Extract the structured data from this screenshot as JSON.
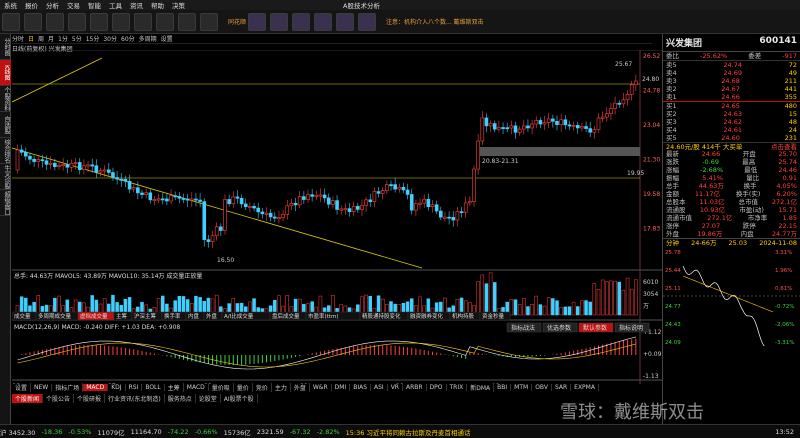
{
  "app": {
    "title": "A股技术分析",
    "logo": "同花顺",
    "notice": "注意：机构介入八个"
  },
  "menu": [
    "系统",
    "报价",
    "分析",
    "交易",
    "智能",
    "工具",
    "资讯",
    "帮助",
    "决策"
  ],
  "toolbar_ticker": "注意：机构介入八个数... 戴维斯双击",
  "leftnav": [
    "分时图",
    "K线图",
    "个股资料",
    "自选股",
    "综合排名",
    "牛叉诊股",
    "超级盘口"
  ],
  "leftnav_active": 1,
  "periods": [
    "分时",
    "日",
    "周",
    "月",
    "1分",
    "5分",
    "15分",
    "30分",
    "60分",
    "多周期",
    "设置"
  ],
  "period_selected": 1,
  "chart_header": "日线(前复权) 兴发集团",
  "price_labels": [
    "26.52",
    "24.78",
    "23.04",
    "21.30",
    "19.58",
    "17.83"
  ],
  "price_annotations": {
    "high": "25.67",
    "right": "24.80",
    "box": "20.83-21.31",
    "line": "19.95",
    "low": "16.50"
  },
  "vol_header": "总手: 44.63万  MAVOL5: 43.89万  MAVOL10: 35.14万  成交量正放量",
  "vol_labels": [
    "6010",
    "3054",
    "万"
  ],
  "indicator_tabs": [
    "成交量",
    "多周期成交量",
    "虚拟成交量",
    "主筹",
    "沪深主筹",
    "换手率",
    "内盘",
    "外盘",
    "A/I比成交量",
    "盘后成交量",
    "市盈率(ttm)",
    "精股通持股变化",
    "融资融券变化",
    "机构持股",
    "资金秒量"
  ],
  "macd_header": "MACD(12,26,9)  MACD: -0.240  DIFF: +1.03  DEA: +0.908",
  "macd_labels": [
    "+1.12",
    "+0.097",
    "-1.13"
  ],
  "chart_buttons": [
    "指标战法",
    "优选参数",
    "默认参数",
    "指标说明"
  ],
  "x_axis": [
    "06",
    "07",
    "08",
    "09",
    "10",
    "11"
  ],
  "bottom_tabs_row1": [
    "设置",
    "NEW",
    "指标广场",
    "MACD",
    "KDJ",
    "RSI",
    "BOLL",
    "主筹",
    "MACD",
    "量价吸",
    "量价",
    "竞价",
    "主力",
    "外盘",
    "W&R",
    "DMI",
    "BIAS",
    "ASI",
    "VR",
    "ARBR",
    "DPO",
    "TRIX",
    "新DMA",
    "BBI",
    "MTM",
    "OBV",
    "SAR",
    "EXPMA"
  ],
  "bottom_tabs_row2": [
    "个股新闻",
    "个股公告",
    "个股研报",
    "行业资讯(东北制造)",
    "服务热点",
    "论股堂",
    "AI股票个股"
  ],
  "quote": {
    "name": "兴发集团",
    "code": "600141",
    "weibi": "-25.62%",
    "weicha": "-917",
    "asks": [
      [
        "5",
        "24.74",
        "72"
      ],
      [
        "4",
        "24.69",
        "49"
      ],
      [
        "3",
        "24.68",
        "211"
      ],
      [
        "2",
        "24.67",
        "441"
      ],
      [
        "1",
        "24.66",
        "355"
      ]
    ],
    "bids": [
      [
        "1",
        "24.65",
        "480"
      ],
      [
        "2",
        "24.63",
        "15"
      ],
      [
        "3",
        "24.62",
        "48"
      ],
      [
        "4",
        "24.61",
        "24"
      ],
      [
        "5",
        "24.60",
        "231"
      ]
    ],
    "last_line": "24.60元/股  414千  大买单",
    "sub_title": "点击查看",
    "fields": [
      [
        "最新",
        "24.66",
        "开盘",
        "25.70"
      ],
      [
        "涨跌",
        "-0.69",
        "最高",
        "25.74"
      ],
      [
        "涨幅",
        "-2.68%",
        "最低",
        "24.46"
      ],
      [
        "振幅",
        "5.41%",
        "量比",
        "0.91"
      ],
      [
        "总手",
        "44.63万",
        "换手",
        "4.05%"
      ],
      [
        "金额",
        "11.17亿",
        "换手(实)",
        "6.20%"
      ],
      [
        "总股本",
        "11.03亿",
        "总市值",
        "272.1亿"
      ],
      [
        "流通股",
        "10.93亿",
        "市盈(动)",
        "15.71"
      ],
      [
        "流通市值",
        "272.1亿",
        "市净率",
        "1.85"
      ],
      [
        "涨停",
        "27.07",
        "跌停",
        "22.15"
      ],
      [
        "外盘",
        "19.86万",
        "内盘",
        "24.77万"
      ]
    ],
    "mini_header": [
      "分钟",
      "24-66万",
      "25.03",
      "2024-11-08"
    ],
    "mini_labels": [
      "25.78",
      "25.44",
      "25.11",
      "24.77",
      "24.43",
      "24.09"
    ],
    "mini_pct": [
      "3.31%",
      "1.96%",
      "0.61%",
      "-0.72%",
      "-2.06%",
      "-3.31%"
    ]
  },
  "status": {
    "sh": "沪 3452.30",
    "sh_chg": "-18.36",
    "sh_pct": "-0.53%",
    "sz": "11079亿",
    "idx2": "11164.70",
    "idx2_chg": "-74.22",
    "idx2_pct": "-0.66%",
    "amount": "15736亿",
    "idx3": "2321.59",
    "idx3_chg": "-67.32",
    "idx3_pct": "-2.82%",
    "news": "15:36 习近平将同赖古拉斯及丹麦首相通话",
    "time": "13:52"
  },
  "watermark": "雪球：戴维斯双击",
  "colors": {
    "up": "#ff4040",
    "down": "#40d0ff",
    "ma5": "#ffffff",
    "ma10": "#ffd000",
    "accent": "#c01010"
  }
}
